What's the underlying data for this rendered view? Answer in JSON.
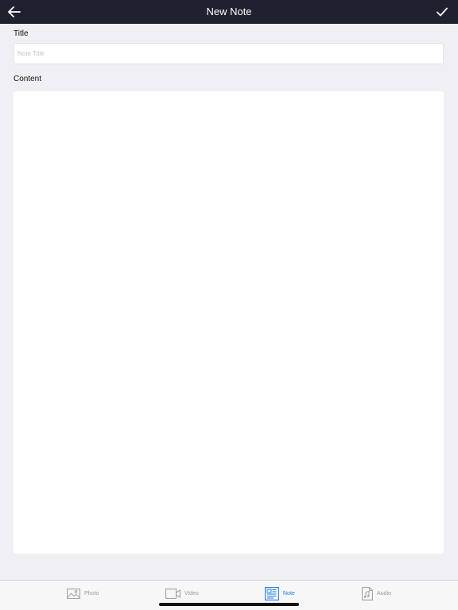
{
  "navbar": {
    "title": "New Note",
    "back_icon": "arrow-left-icon",
    "done_icon": "checkmark-icon"
  },
  "form": {
    "title_label": "Title",
    "title_placeholder": "Note Title",
    "title_value": "",
    "content_label": "Content",
    "content_value": ""
  },
  "tabbar": {
    "tabs": [
      {
        "label": "Photo",
        "icon": "photo-icon",
        "active": false
      },
      {
        "label": "Video",
        "icon": "video-icon",
        "active": false
      },
      {
        "label": "Note",
        "icon": "note-icon",
        "active": true
      },
      {
        "label": "Audio",
        "icon": "audio-icon",
        "active": false
      }
    ]
  },
  "colors": {
    "navbar_bg": "#1f2030",
    "page_bg": "#efeff4",
    "accent": "#1a7ee0",
    "inactive": "#9a9a9f"
  }
}
